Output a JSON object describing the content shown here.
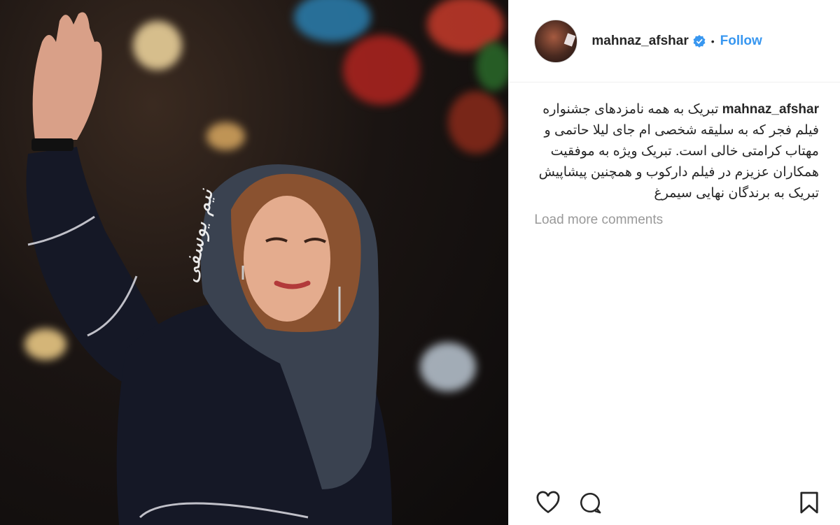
{
  "post": {
    "username": "mahnaz_afshar",
    "separator": "•",
    "follow_label": "Follow",
    "watermark": "نیم یوسفی",
    "caption_user": "mahnaz_afshar",
    "caption_text": "تبریک به همه نامزدهای جشنواره فیلم فجر که به سلیقه شخصی ام جای لیلا حاتمی و مهتاب کرامتی خالی است. تبریک ویژه به موفقیت همکاران عزیزم در فیلم دارکوب و همچنین پیشاپیش تبریک به برندگان نهایی سیمرغ",
    "load_more": "Load more comments"
  },
  "icons": {
    "verified": "verified-badge-icon",
    "like": "heart-icon",
    "comment": "comment-icon",
    "save": "bookmark-icon"
  },
  "colors": {
    "follow": "#3897f0",
    "verified": "#3897f0",
    "muted": "#999999",
    "text": "#262626"
  }
}
